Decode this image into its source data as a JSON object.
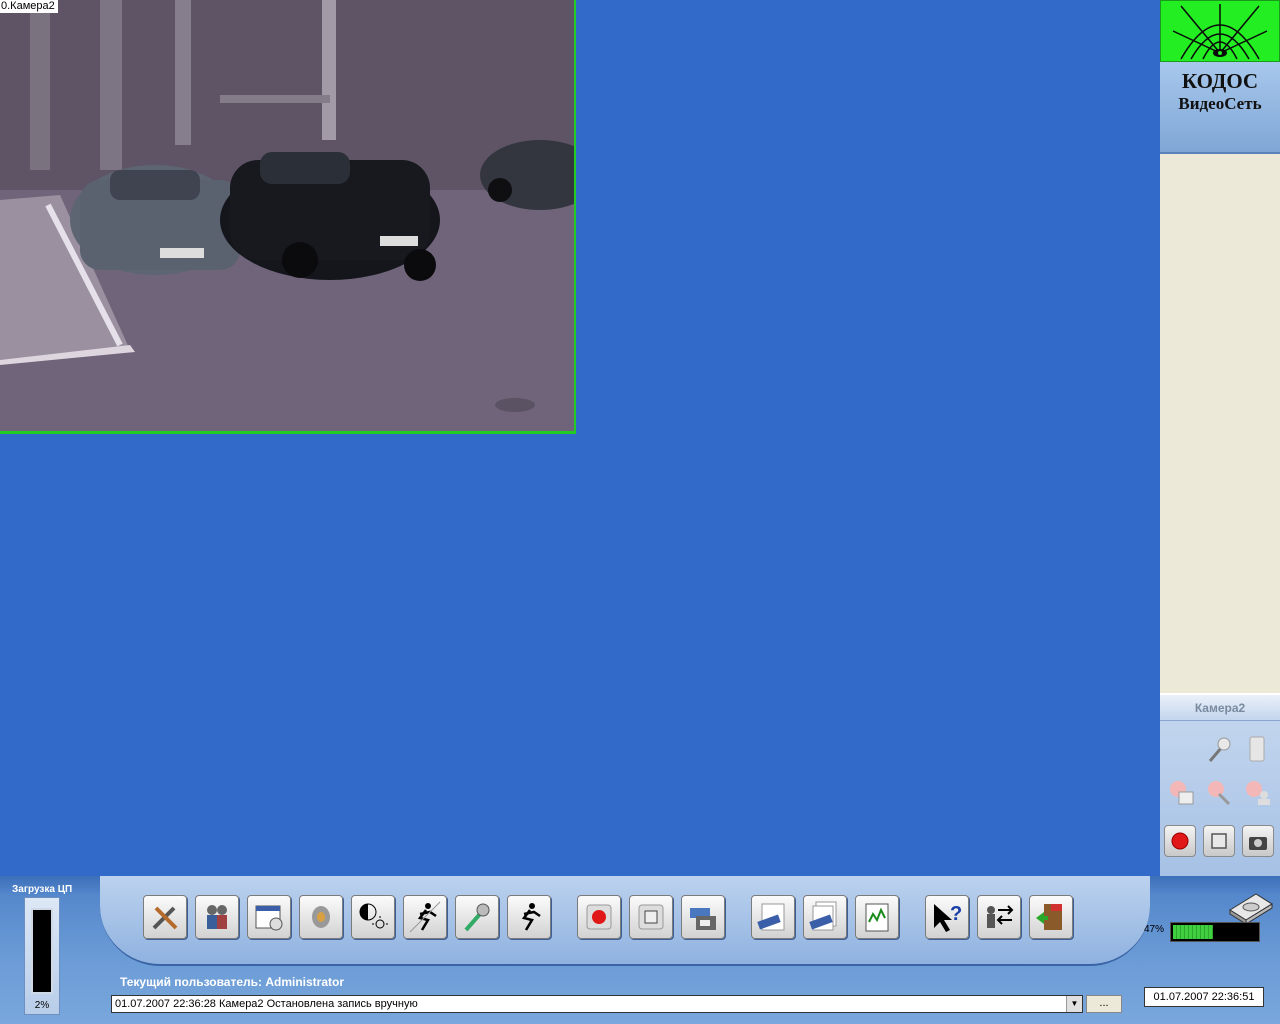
{
  "camera_view": {
    "label": "0.Камера2"
  },
  "logo": {
    "line1": "КОДОС",
    "line2": "ВидеоСеть"
  },
  "camera_panel": {
    "title": "Камера2",
    "icons": [
      "microphone-icon",
      "speaker-icon",
      "camera-add-icon",
      "camera-search-icon",
      "camera-user-icon"
    ],
    "buttons": [
      "record-icon",
      "stop-icon",
      "snapshot-icon"
    ]
  },
  "cpu": {
    "label": "Загрузка ЦП",
    "value": "2%"
  },
  "toolbar": {
    "buttons": [
      "settings-tools-icon",
      "users-icon",
      "schedule-icon",
      "audio-icon",
      "brightness-icon",
      "motion-zone-icon",
      "microphone-icon",
      "motion-detect-icon",
      "record-icon",
      "stop-icon",
      "archive-save-icon",
      "camera-view-icon",
      "cameras-multi-icon",
      "report-icon",
      "help-icon",
      "user-switch-icon",
      "exit-icon"
    ]
  },
  "status": {
    "user_label": "Текущий пользователь: Administrator",
    "log_text": "01.07.2007 22:36:28 Камера2  Остановлена запись вручную",
    "more_label": "..."
  },
  "disk": {
    "percent": "47%",
    "fill": 0.47
  },
  "datetime": "01.07.2007 22:36:51",
  "colors": {
    "desktop": "#316ac8",
    "accent_green": "#22ee22",
    "panel": "#ece9d8"
  }
}
